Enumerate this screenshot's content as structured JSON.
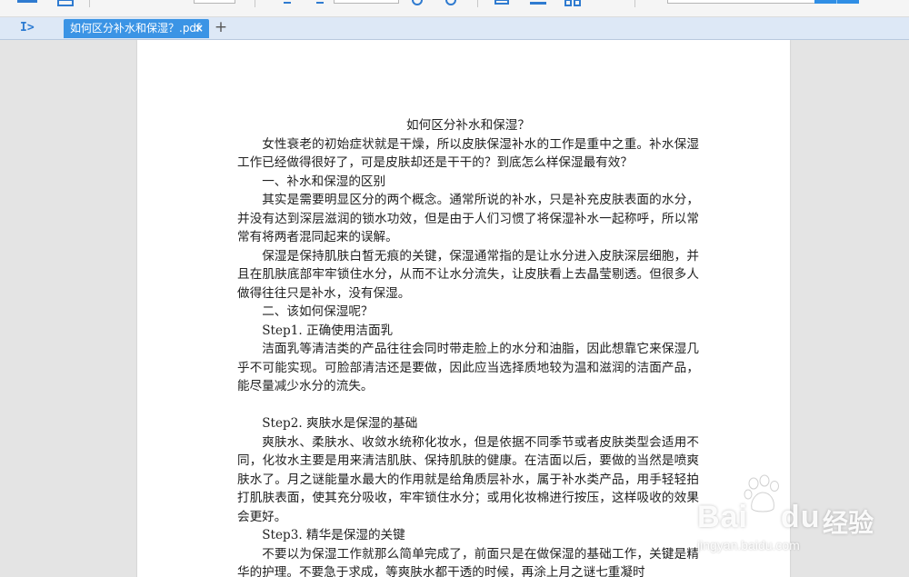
{
  "tabbar": {
    "sidebar_toggle_icon": "sidebar-expand-icon",
    "active_tab": {
      "label": "如何区分补水和保湿？.pdf",
      "close_glyph": "×"
    },
    "add_tab_glyph": "+"
  },
  "colors": {
    "tab_active": "#3b94e5",
    "tabbar_bg": "#dde8f6",
    "viewer_bg": "#e4e4e4",
    "search_button": "#2f8ee5"
  },
  "document": {
    "title": "如何区分补水和保湿？",
    "blocks": [
      {
        "type": "para",
        "text": "女性衰老的初始症状就是干燥，所以皮肤保湿补水的工作是重中之重。补水保湿工作已经做得很好了，可是皮肤却还是干干的？到底怎么样保湿最有效？"
      },
      {
        "type": "heading",
        "text": "一、补水和保湿的区别"
      },
      {
        "type": "para",
        "text": "其实是需要明显区分的两个概念。通常所说的补水，只是补充皮肤表面的水分，并没有达到深层滋润的锁水功效，但是由于人们习惯了将保湿补水一起称呼，所以常常有将两者混同起来的误解。"
      },
      {
        "type": "para",
        "text": "保湿是保持肌肤白皙无痕的关键，保湿通常指的是让水分进入皮肤深层细胞，并且在肌肤底部牢牢锁住水分，从而不让水分流失，让皮肤看上去晶莹剔透。但很多人做得往往只是补水，没有保湿。"
      },
      {
        "type": "heading",
        "text": "二、该如何保湿呢？"
      },
      {
        "type": "heading",
        "text": "Step1. 正确使用洁面乳"
      },
      {
        "type": "para",
        "text": "洁面乳等清洁类的产品往往会同时带走脸上的水分和油脂，因此想靠它来保湿几乎不可能实现。可脸部清洁还是要做，因此应当选择质地较为温和滋润的洁面产品，能尽量减少水分的流失。"
      },
      {
        "type": "spacer",
        "text": ""
      },
      {
        "type": "heading",
        "text": "Step2. 爽肤水是保湿的基础"
      },
      {
        "type": "para",
        "text": "爽肤水、柔肤水、收敛水统称化妆水，但是依据不同季节或者皮肤类型会适用不同，化妆水主要是用来清洁肌肤、保持肌肤的健康。在洁面以后，要做的当然是喷爽肤水了。月之谜能量水最大的作用就是给角质层补水，属于补水类产品，用手轻轻拍打肌肤表面，使其充分吸收，牢牢锁住水分；或用化妆棉进行按压，这样吸收的效果会更好。"
      },
      {
        "type": "heading",
        "text": "Step3. 精华是保湿的关键"
      },
      {
        "type": "para",
        "text": "不要以为保湿工作就那么简单完成了，前面只是在做保湿的基础工作，关键是精华的护理。不要急于求成，等爽肤水都干透的时候，再涂上月之谜七重凝时"
      }
    ]
  },
  "watermark": {
    "logo_text": "Bai",
    "logo_paw_icon": "baidu-paw-icon",
    "logo_suffix": "du",
    "brand_cn": "经验",
    "url": "jingyan.baidu.com"
  }
}
